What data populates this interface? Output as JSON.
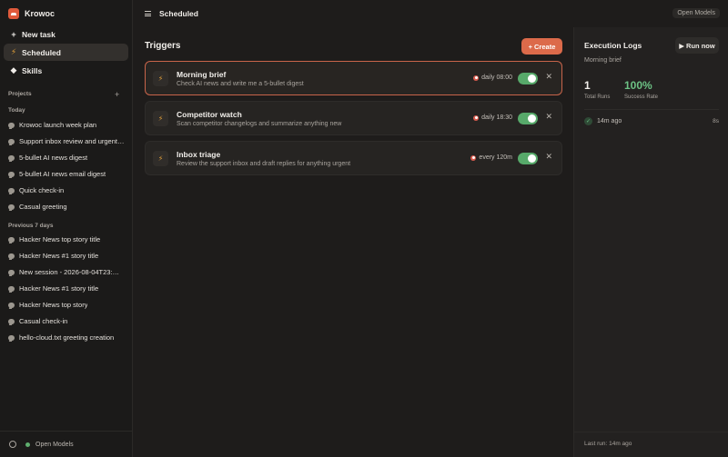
{
  "app": {
    "name": "Krowoc"
  },
  "sidebar": {
    "new_task": "New task",
    "scheduled": "Scheduled",
    "skills": "Skills",
    "projects_label": "Projects",
    "groups": [
      {
        "label": "Today",
        "items": [
          "Krowoc launch week plan",
          "Support inbox review and urgent…",
          "5-bullet AI news digest",
          "5-bullet AI news email digest",
          "Quick check-in",
          "Casual greeting"
        ]
      },
      {
        "label": "Previous 7 days",
        "items": [
          "Hacker News top story title",
          "Hacker News #1 story title",
          "New session - 2026-08-04T23:…",
          "Hacker News #1 story title",
          "Hacker News top story",
          "Casual check-in",
          "hello-cloud.txt greeting creation"
        ]
      }
    ],
    "footer_label": "Open Models"
  },
  "topbar": {
    "title": "Scheduled",
    "badge": "Open Models"
  },
  "triggers": {
    "title": "Triggers",
    "create_label": "Create",
    "items": [
      {
        "name": "Morning brief",
        "desc": "Check AI news and write me a 5-bullet digest",
        "schedule": "daily 08:00",
        "enabled": true
      },
      {
        "name": "Competitor watch",
        "desc": "Scan competitor changelogs and summarize anything new",
        "schedule": "daily 18:30",
        "enabled": true
      },
      {
        "name": "Inbox triage",
        "desc": "Review the support inbox and draft replies for anything urgent",
        "schedule": "every 120m",
        "enabled": true
      }
    ]
  },
  "logs": {
    "title": "Execution Logs",
    "run_label": "Run now",
    "subtitle": "Morning brief",
    "total_runs_value": "1",
    "total_runs_label": "Total Runs",
    "success_value": "100%",
    "success_label": "Success Rate",
    "entries": [
      {
        "time": "14m ago",
        "duration": "8s"
      }
    ],
    "footer": "Last run: 14m ago"
  },
  "colors": {
    "accent": "#dc6a4a",
    "toggle_on": "#57a96a",
    "success": "#6cc184"
  }
}
